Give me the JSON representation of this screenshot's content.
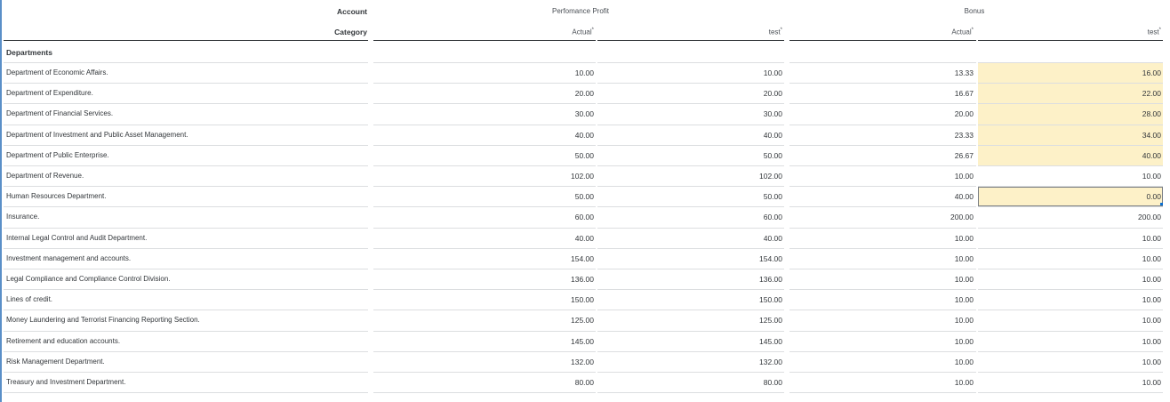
{
  "header": {
    "account_label": "Account",
    "category_label": "Category",
    "measure_1": "Perfomance Profit",
    "measure_2": "Bonus",
    "version_actual": "Actual",
    "version_test": "test",
    "required_marker": "*"
  },
  "group_label": "Departments",
  "columns": [
    "Perfomance Profit · Actual",
    "Perfomance Profit · test",
    "Bonus · Actual",
    "Bonus · test"
  ],
  "rows": [
    {
      "label": "Department of Economic Affairs.",
      "values": [
        "10.00",
        "10.00",
        "13.33",
        "16.00"
      ],
      "highlight": true
    },
    {
      "label": "Department of Expenditure.",
      "values": [
        "20.00",
        "20.00",
        "16.67",
        "22.00"
      ],
      "highlight": true
    },
    {
      "label": "Department of Financial Services.",
      "values": [
        "30.00",
        "30.00",
        "20.00",
        "28.00"
      ],
      "highlight": true
    },
    {
      "label": "Department of Investment and Public Asset Management.",
      "values": [
        "40.00",
        "40.00",
        "23.33",
        "34.00"
      ],
      "highlight": true
    },
    {
      "label": "Department of Public Enterprise.",
      "values": [
        "50.00",
        "50.00",
        "26.67",
        "40.00"
      ],
      "highlight": true
    },
    {
      "label": "Department of Revenue.",
      "values": [
        "102.00",
        "102.00",
        "10.00",
        "10.00"
      ],
      "highlight": false
    },
    {
      "label": "Human Resources Department.",
      "values": [
        "50.00",
        "50.00",
        "40.00",
        "0.00"
      ],
      "highlight": true,
      "selected": true
    },
    {
      "label": "Insurance.",
      "values": [
        "60.00",
        "60.00",
        "200.00",
        "200.00"
      ],
      "highlight": false
    },
    {
      "label": "Internal Legal Control and Audit Department.",
      "values": [
        "40.00",
        "40.00",
        "10.00",
        "10.00"
      ],
      "highlight": false
    },
    {
      "label": "Investment management and accounts.",
      "values": [
        "154.00",
        "154.00",
        "10.00",
        "10.00"
      ],
      "highlight": false
    },
    {
      "label": "Legal Compliance and Compliance Control Division.",
      "values": [
        "136.00",
        "136.00",
        "10.00",
        "10.00"
      ],
      "highlight": false
    },
    {
      "label": "Lines of credit.",
      "values": [
        "150.00",
        "150.00",
        "10.00",
        "10.00"
      ],
      "highlight": false
    },
    {
      "label": "Money Laundering and Terrorist Financing Reporting Section.",
      "values": [
        "125.00",
        "125.00",
        "10.00",
        "10.00"
      ],
      "highlight": false
    },
    {
      "label": "Retirement and education accounts.",
      "values": [
        "145.00",
        "145.00",
        "10.00",
        "10.00"
      ],
      "highlight": false
    },
    {
      "label": "Risk Management Department.",
      "values": [
        "132.00",
        "132.00",
        "10.00",
        "10.00"
      ],
      "highlight": false
    },
    {
      "label": "Treasury and Investment Department.",
      "values": [
        "80.00",
        "80.00",
        "10.00",
        "10.00"
      ],
      "highlight": false
    }
  ],
  "colors": {
    "input_highlight": "#fdf1c8",
    "selection_border": "#7b7f84",
    "row_divider": "#dcdee0",
    "left_edge": "#5a8fc8"
  }
}
